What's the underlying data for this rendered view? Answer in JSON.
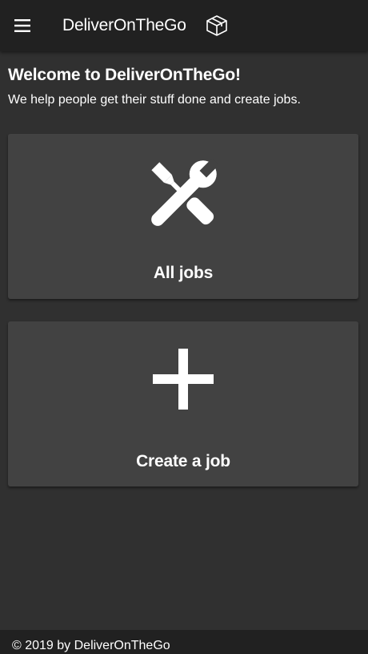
{
  "header": {
    "title": "DeliverOnTheGo",
    "menu_icon": "menu-icon",
    "logo_icon": "box-icon"
  },
  "welcome": {
    "title": "Welcome to DeliverOnTheGo!",
    "subtitle": "We help people get their stuff done and create jobs."
  },
  "cards": [
    {
      "label": "All jobs",
      "icon": "tools-icon"
    },
    {
      "label": "Create a job",
      "icon": "plus-icon"
    }
  ],
  "footer": {
    "text": "© 2019 by DeliverOnTheGo"
  },
  "colors": {
    "background": "#303030",
    "app_bar": "#212121",
    "card": "#424242",
    "text": "#ffffff"
  }
}
